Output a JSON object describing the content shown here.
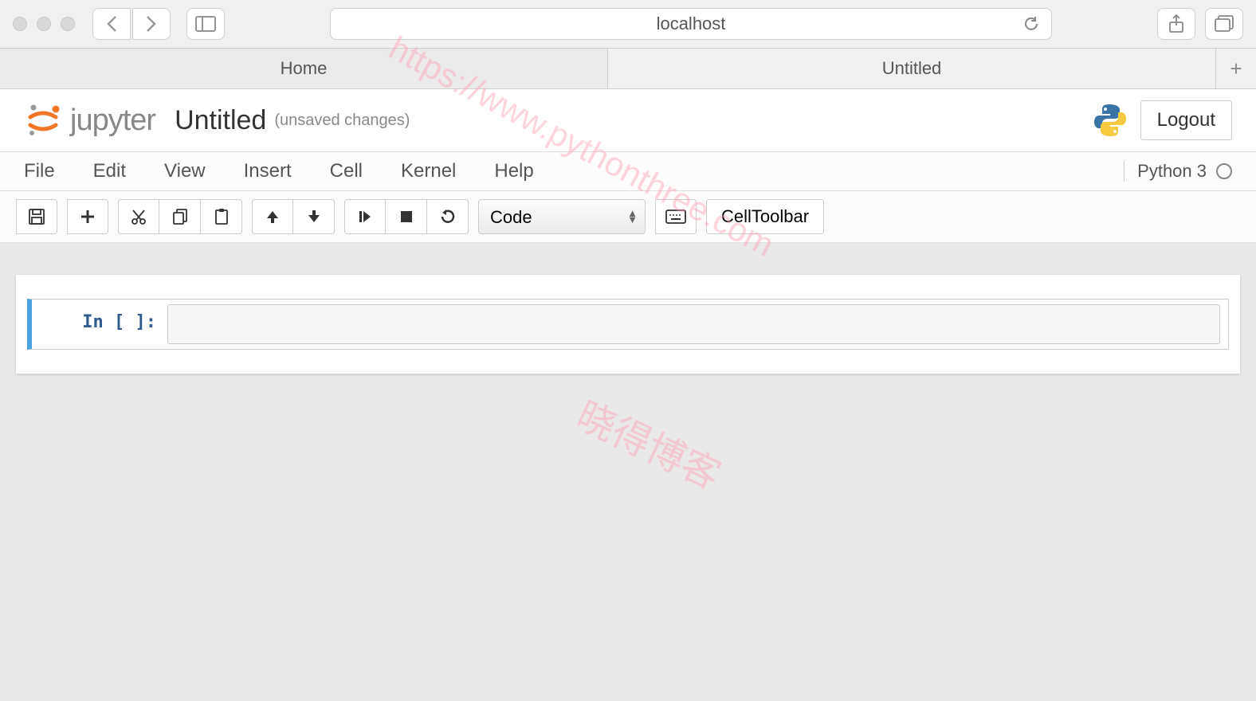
{
  "browser": {
    "url": "localhost",
    "tabs": [
      "Home",
      "Untitled"
    ]
  },
  "header": {
    "logo_text": "jupyter",
    "notebook_name": "Untitled",
    "save_status": "(unsaved changes)",
    "logout_label": "Logout"
  },
  "menu": {
    "items": [
      "File",
      "Edit",
      "View",
      "Insert",
      "Cell",
      "Kernel",
      "Help"
    ],
    "kernel_name": "Python 3"
  },
  "toolbar": {
    "cell_type": "Code",
    "cell_toolbar_label": "CellToolbar"
  },
  "cell": {
    "prompt": "In [ ]:"
  },
  "watermark": {
    "url": "https://www.pythonthree.com",
    "text": "晓得博客"
  }
}
